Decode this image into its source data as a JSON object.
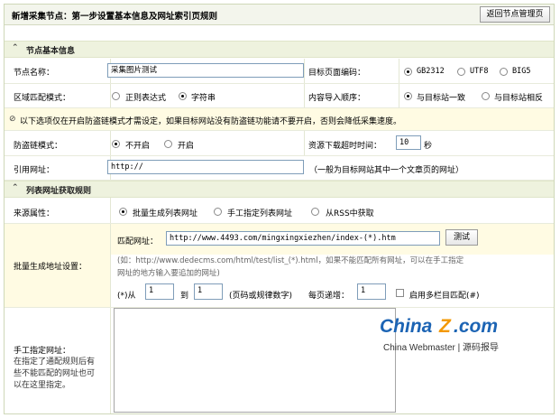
{
  "header": {
    "title": "新增采集节点：第一步设置基本信息及网址索引页规则",
    "back_button": "返回节点管理页"
  },
  "section_basic": {
    "title": "节点基本信息"
  },
  "node_name": {
    "label": "节点名称：",
    "value": "采集图片测试"
  },
  "encoding": {
    "label": "目标页面编码：",
    "options": [
      "GB2312",
      "UTF8",
      "BIG5"
    ],
    "selected": "GB2312"
  },
  "match_mode": {
    "label": "区域匹配模式：",
    "options": [
      "正则表达式",
      "字符串"
    ],
    "selected": "字符串"
  },
  "import_order": {
    "label": "内容导入顺序：",
    "options": [
      "与目标站一致",
      "与目标站相反"
    ],
    "selected": "与目标站一致"
  },
  "notice": "以下选项仅在开启防盗链模式才需设定，如果目标网站没有防盗链功能请不要开启，否则会降低采集速度。",
  "anti_leech": {
    "label": "防盗链模式：",
    "options": [
      "不开启",
      "开启"
    ],
    "selected": "不开启"
  },
  "timeout": {
    "label": "资源下载超时时间：",
    "value": "10",
    "unit": "秒"
  },
  "referer": {
    "label": "引用网址：",
    "value": "http://",
    "hint": "（一般为目标网站其中一个文章页的网址）"
  },
  "section_list": {
    "title": "列表网址获取规则"
  },
  "source": {
    "label": "来源属性：",
    "options": [
      "批量生成列表网址",
      "手工指定列表网址",
      "从RSS中获取"
    ],
    "selected": "批量生成列表网址"
  },
  "batch": {
    "label": "批量生成地址设置：",
    "match_label": "匹配网址：",
    "match_value": "http://www.4493.com/mingxingxiezhen/index-(*).htm",
    "test_button": "测试",
    "example_line1": "(如：http://www.dedecms.com/html/test/list_(*).html，如果不能匹配所有网址，可以在手工指定",
    "example_line2": "网址的地方输入要追加的网址)",
    "from_label": "(*)从",
    "from_value": "1",
    "to_label": "到",
    "to_value": "1",
    "page_hint": "(页码或规律数字)",
    "step_label": "每页递增：",
    "step_value": "1",
    "multi_label": "启用多栏目匹配(#)"
  },
  "manual": {
    "label": "手工指定网址：",
    "note": "在指定了通配规则后有些不能匹配的网址也可以在这里指定。"
  },
  "watermark": {
    "brand_main": "China",
    "brand_z": "Z",
    "brand_tail": ".com",
    "sub": "China Webmaster | 源码报导"
  },
  "colors": {
    "brand_blue": "#1c64b4",
    "brand_orange": "#f39800",
    "section_bg": "#eef2de",
    "notice_bg": "#fffbe3"
  }
}
